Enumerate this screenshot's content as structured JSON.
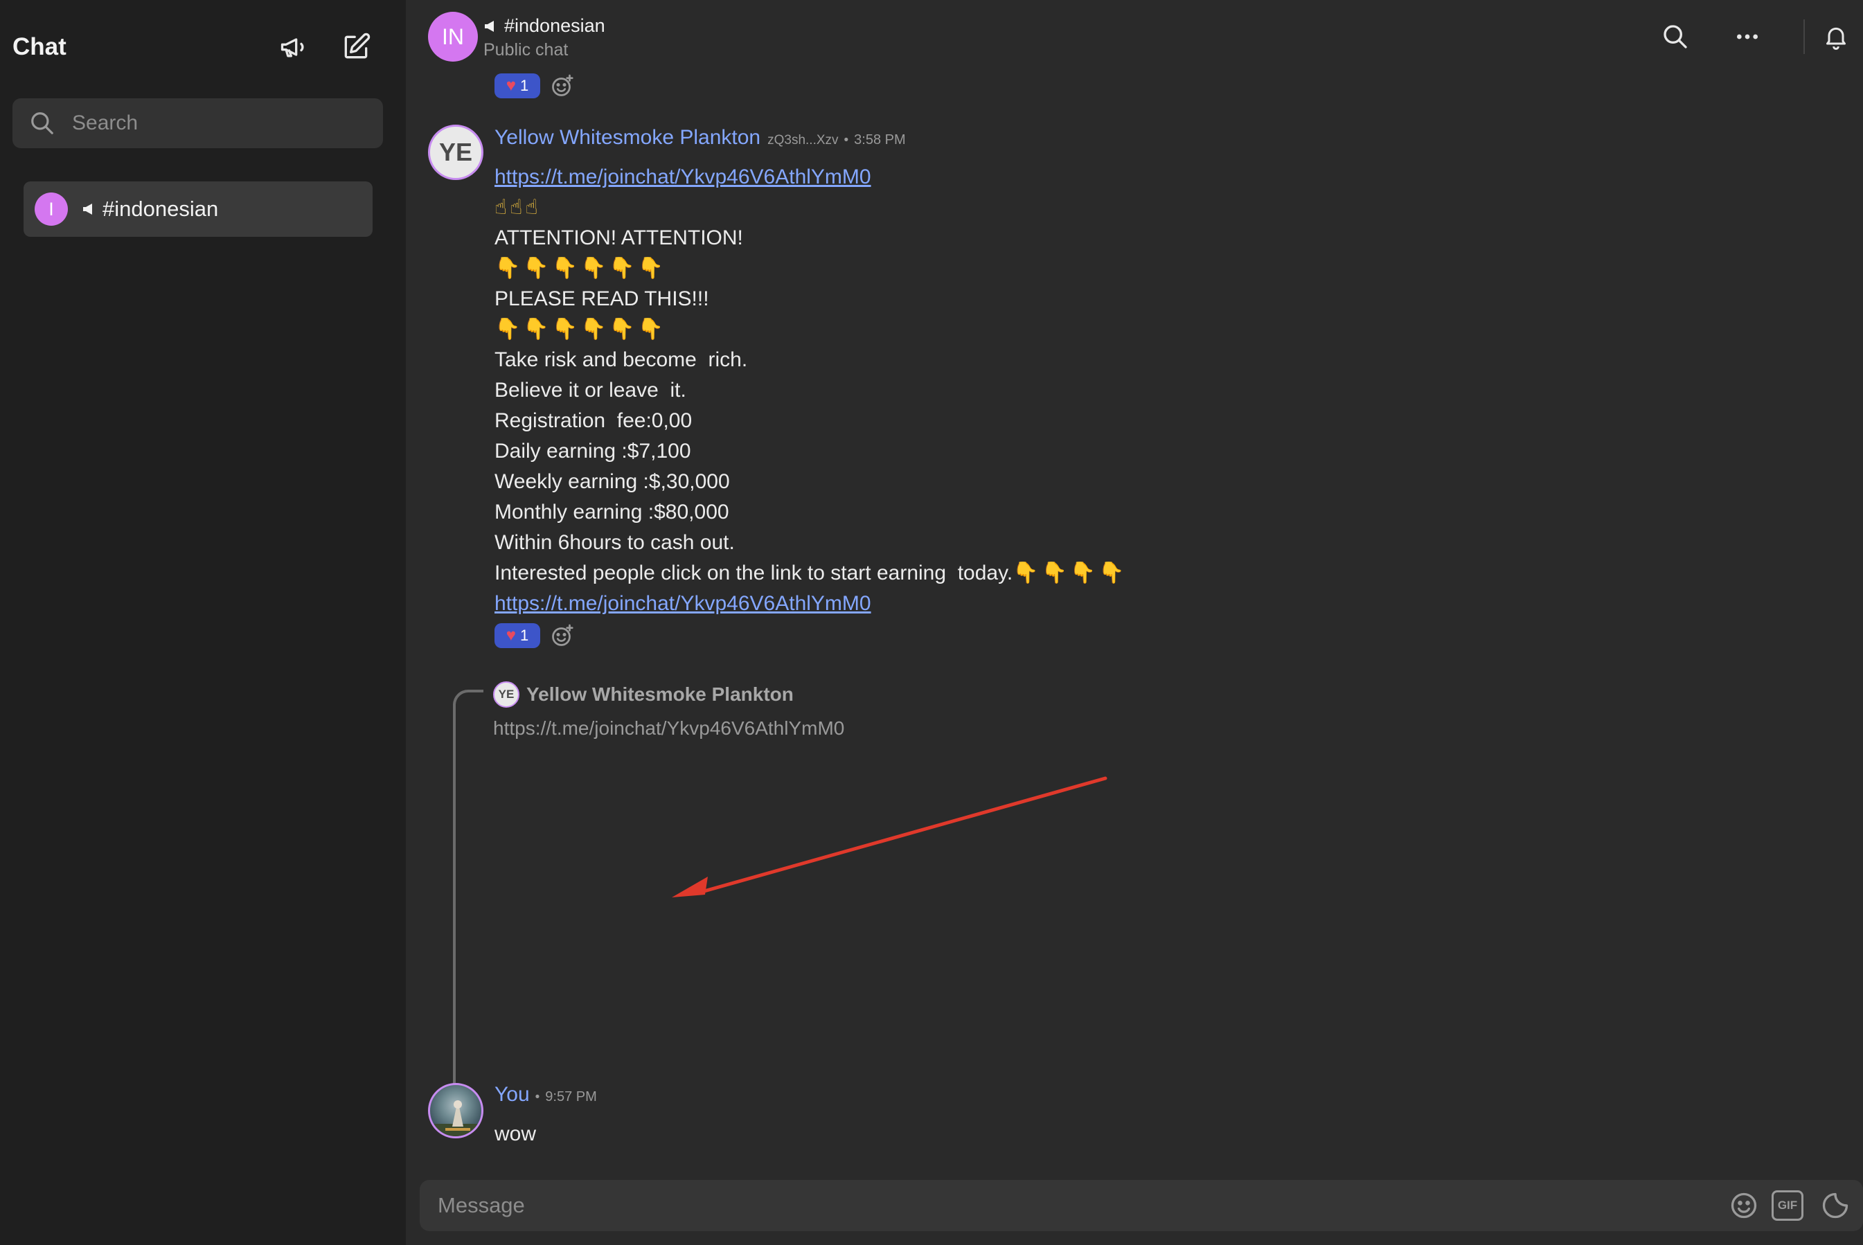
{
  "sidebar": {
    "title": "Chat",
    "search_placeholder": "Search",
    "chats": [
      {
        "avatar_letter": "I",
        "name": "#indonesian"
      }
    ]
  },
  "header": {
    "avatar_letters": "IN",
    "channel_name": "#indonesian",
    "subtitle": "Public chat"
  },
  "messages": [
    {
      "author": "Yellow Whitesmoke Plankton",
      "avatar_letters": "YE",
      "handle": "zQ3sh...Xzv",
      "separator": "•",
      "time": "3:58 PM",
      "lines": [
        "https://t.me/joinchat/Ykvp46V6AthlYmM0",
        "☝☝☝",
        "ATTENTION! ATTENTION!",
        "👇👇👇👇👇👇",
        "PLEASE READ THIS!!!",
        "👇👇👇👇👇👇",
        "Take risk and become  rich.",
        "Believe it or leave  it.",
        "Registration  fee:0,00",
        "Daily earning :$7,100",
        "Weekly earning :$,30,000",
        "Monthly earning :$80,000",
        "Within 6hours to cash out.",
        "Interested people click on the link to start earning  today.",
        "👇👇👇👇",
        "https://t.me/joinchat/Ykvp46V6AthlYmM0"
      ],
      "reaction_count": "1"
    },
    {
      "author": "You",
      "separator": "•",
      "time": "9:57 PM",
      "text": "wow",
      "reply_to": {
        "author": "Yellow Whitesmoke Plankton",
        "avatar_letters": "YE",
        "text": "https://t.me/joinchat/Ykvp46V6AthlYmM0"
      }
    }
  ],
  "top_reaction_count": "1",
  "composer": {
    "placeholder": "Message",
    "gif_label": "GIF"
  },
  "colors": {
    "accent_link": "#84a7ff",
    "avatar_channel": "#d477f0",
    "reaction_bg": "#3d55c9",
    "annotation_arrow": "#e0392b"
  },
  "icons": [
    "megaphone-icon",
    "edit-icon",
    "search-icon",
    "more-icon",
    "bell-icon",
    "heart-icon",
    "add-reaction-icon",
    "emoji-icon",
    "gif-icon",
    "sticker-icon"
  ]
}
